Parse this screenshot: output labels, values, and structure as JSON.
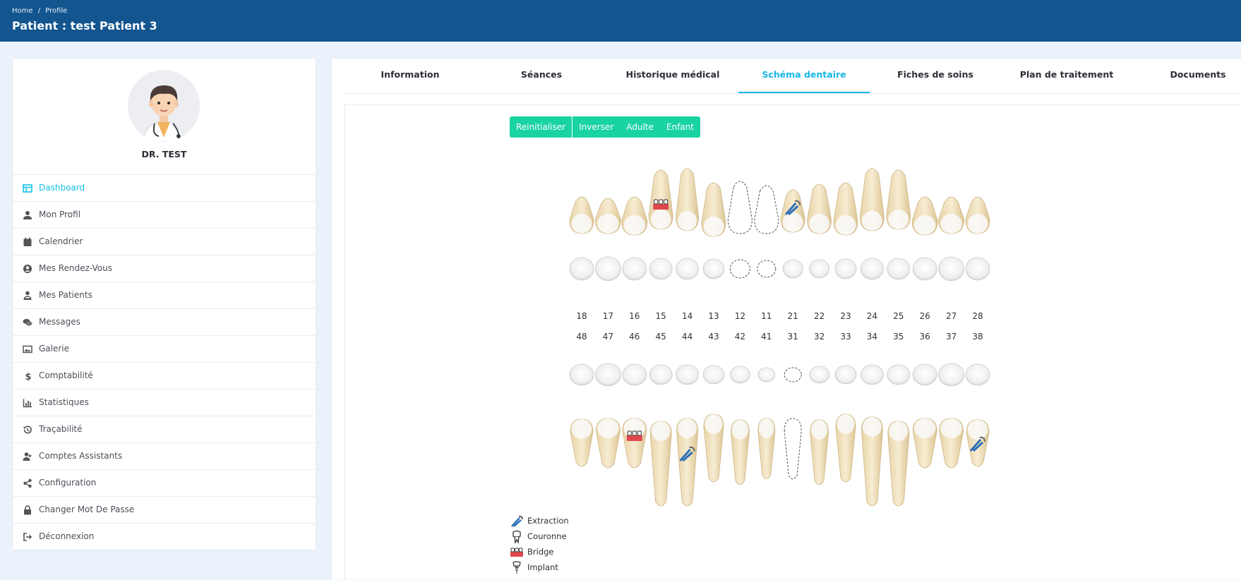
{
  "breadcrumb": {
    "home": "Home",
    "sep": "/",
    "current": "Profile"
  },
  "page_title": "Patient : test Patient 3",
  "doctor_name": "DR. TEST",
  "menu": [
    {
      "label": "Dashboard",
      "icon": "dashboard-icon",
      "active": true
    },
    {
      "label": "Mon Profil",
      "icon": "user-icon"
    },
    {
      "label": "Calendrier",
      "icon": "calendar-icon"
    },
    {
      "label": "Mes Rendez-Vous",
      "icon": "user-circle-icon"
    },
    {
      "label": "Mes Patients",
      "icon": "patients-icon"
    },
    {
      "label": "Messages",
      "icon": "comments-icon"
    },
    {
      "label": "Galerie",
      "icon": "image-icon"
    },
    {
      "label": "Comptabilité",
      "icon": "dollar-icon"
    },
    {
      "label": "Statistiques",
      "icon": "bar-chart-icon"
    },
    {
      "label": "Traçabilité",
      "icon": "history-icon"
    },
    {
      "label": "Comptes Assistants",
      "icon": "user-plus-icon"
    },
    {
      "label": "Configuration",
      "icon": "share-icon"
    },
    {
      "label": "Changer Mot De Passe",
      "icon": "lock-icon"
    },
    {
      "label": "Déconnexion",
      "icon": "sign-out-icon"
    }
  ],
  "tabs": [
    {
      "label": "Information"
    },
    {
      "label": "Séances"
    },
    {
      "label": "Historique médical"
    },
    {
      "label": "Schéma dentaire",
      "active": true
    },
    {
      "label": "Fiches de soins"
    },
    {
      "label": "Plan de traitement"
    },
    {
      "label": "Documents"
    }
  ],
  "chart_buttons": [
    "Reinitialiser",
    "Inverser",
    "Adulte",
    "Enfant"
  ],
  "upper_numbers": [
    "18",
    "17",
    "16",
    "15",
    "14",
    "13",
    "12",
    "11",
    "21",
    "22",
    "23",
    "24",
    "25",
    "26",
    "27",
    "28"
  ],
  "lower_numbers": [
    "48",
    "47",
    "46",
    "45",
    "44",
    "43",
    "42",
    "41",
    "31",
    "32",
    "33",
    "34",
    "35",
    "36",
    "37",
    "38"
  ],
  "legend": [
    {
      "label": "Extraction",
      "icon": "extraction-icon"
    },
    {
      "label": "Couronne",
      "icon": "crown-icon"
    },
    {
      "label": "Bridge",
      "icon": "bridge-icon"
    },
    {
      "label": "Implant",
      "icon": "implant-icon"
    }
  ],
  "colors": {
    "header": "#13558f",
    "accent": "#14b8e4",
    "button": "#19d3a2",
    "tooth": "#efdcb4"
  }
}
